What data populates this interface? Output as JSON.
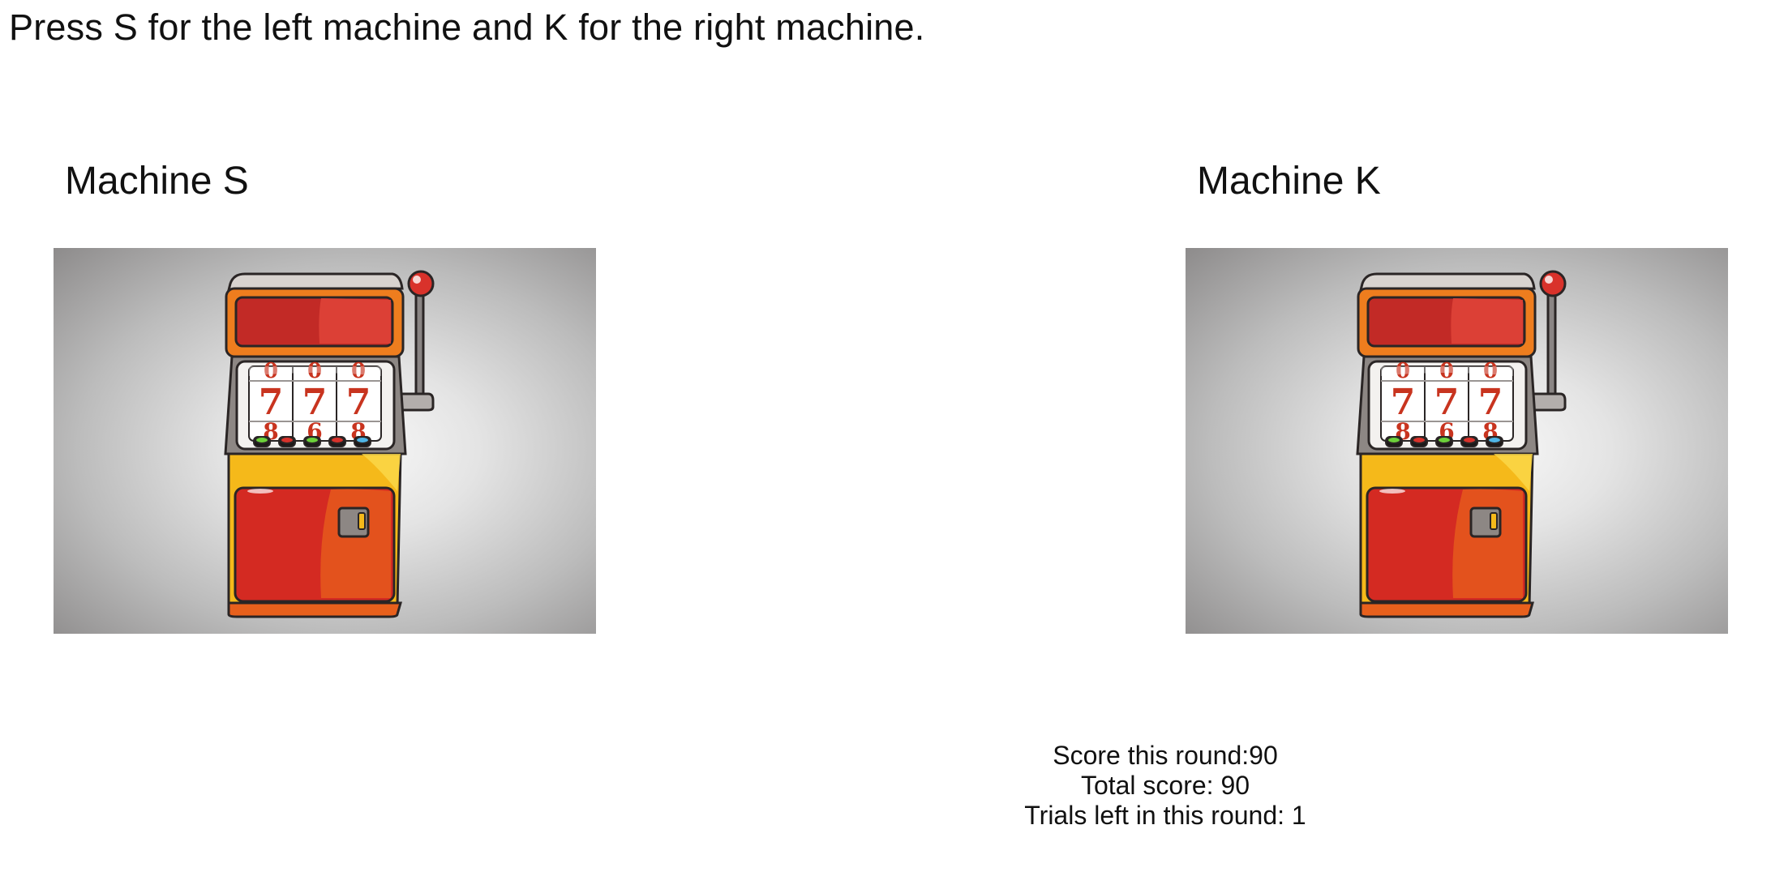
{
  "instruction": "Press S for the left machine and K for the right machine.",
  "machines": [
    {
      "title": "Machine S",
      "key": "S",
      "reel_digits": {
        "top": [
          "0",
          "0",
          "0"
        ],
        "middle": [
          "7",
          "7",
          "7"
        ],
        "bottom": [
          "8",
          "6",
          "8"
        ]
      }
    },
    {
      "title": "Machine K",
      "key": "K",
      "reel_digits": {
        "top": [
          "0",
          "0",
          "0"
        ],
        "middle": [
          "7",
          "7",
          "7"
        ],
        "bottom": [
          "8",
          "6",
          "8"
        ]
      }
    }
  ],
  "scores": {
    "round": "Score this round:90",
    "total": "Total score: 90",
    "trials": "Trials left in this round: 1"
  },
  "colors": {
    "cabinet_orange": "#e8601c",
    "cabinet_yellow": "#f5b91a",
    "display_red": "#c22a26",
    "digit_red": "#c8341f",
    "lever_ball": "#d9322b",
    "button_green": "#6cd13a",
    "button_red": "#d9322b",
    "button_blue": "#4fb5e6"
  },
  "icons": [
    "slot-machine-icon",
    "lever-icon",
    "coin-slot-icon"
  ]
}
